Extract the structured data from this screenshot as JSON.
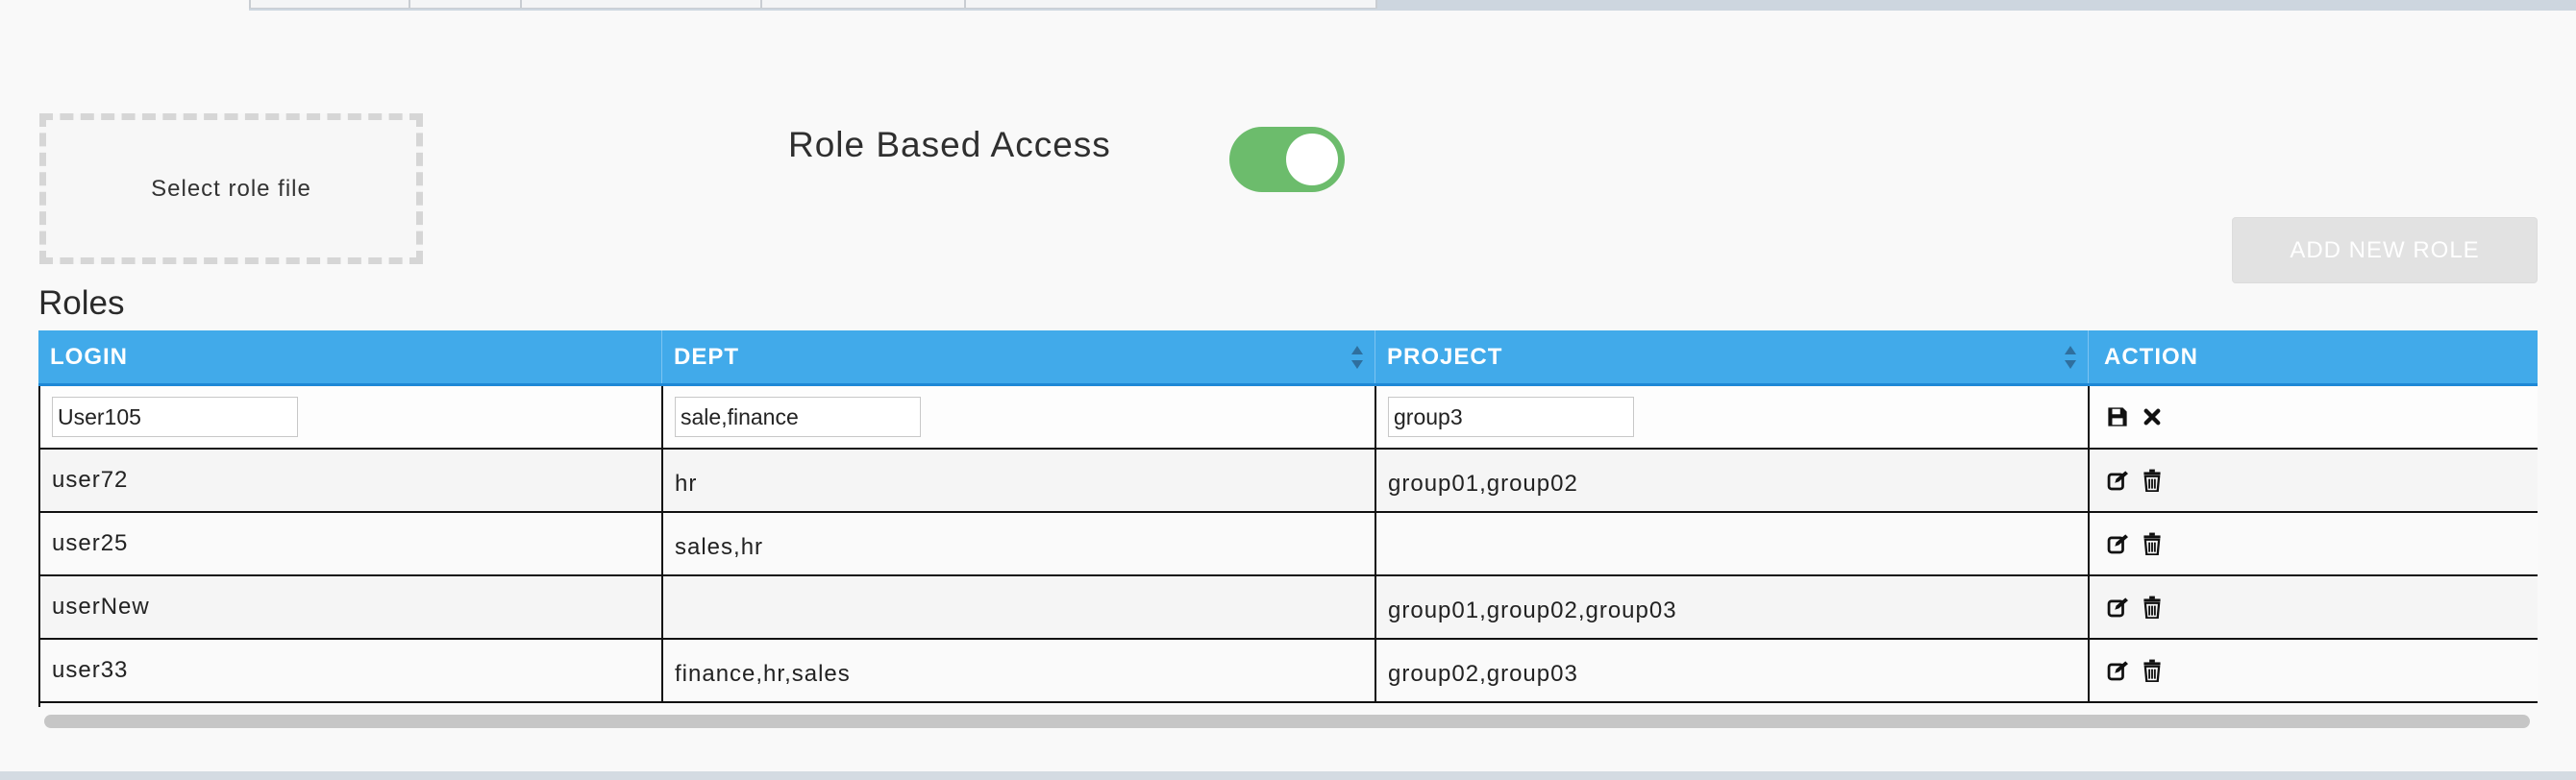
{
  "upload": {
    "label": "Select role file"
  },
  "rba": {
    "label": "Role Based Access",
    "enabled": true,
    "color": "#6cbc6c"
  },
  "add_button": {
    "label": "ADD NEW ROLE"
  },
  "roles": {
    "title": "Roles",
    "columns": [
      "LOGIN",
      "DEPT",
      "PROJECT",
      "ACTION"
    ],
    "edit_row": {
      "login": "User105",
      "dept": "sale,finance",
      "project": "group3"
    },
    "rows": [
      {
        "login": "user72",
        "dept": "hr",
        "project": "group01,group02"
      },
      {
        "login": "user25",
        "dept": "sales,hr",
        "project": ""
      },
      {
        "login": "userNew",
        "dept": "",
        "project": "group01,group02,group03"
      },
      {
        "login": "user33",
        "dept": "finance,hr,sales",
        "project": "group02,group03"
      }
    ]
  },
  "colors": {
    "header_bg": "#41aaea",
    "accent": "#6cbc6c"
  },
  "icons": {
    "save": "save-icon",
    "cancel": "close-icon",
    "edit": "edit-icon",
    "delete": "trash-icon"
  }
}
